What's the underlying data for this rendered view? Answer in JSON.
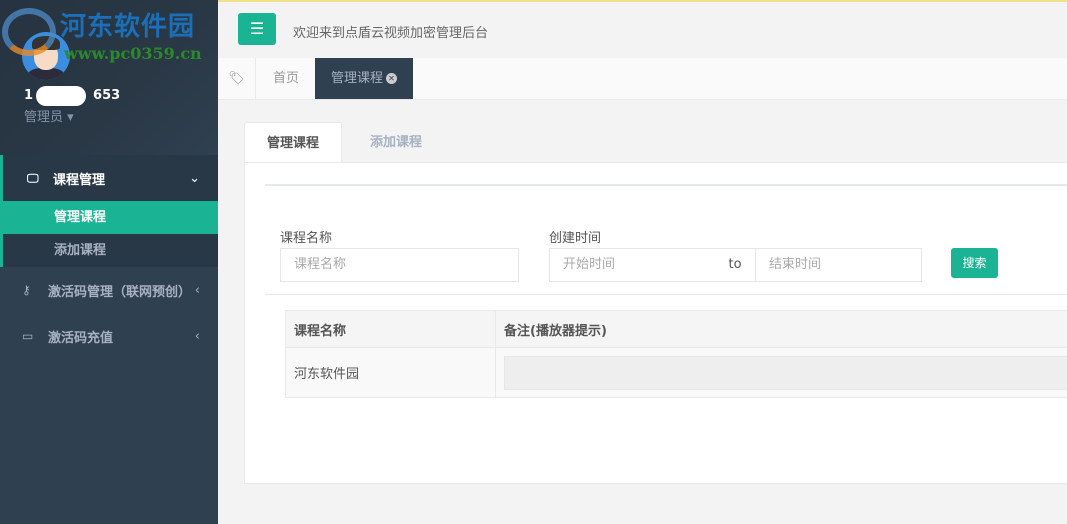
{
  "watermark": {
    "title": "河东软件园",
    "url": "www.pc0359.cn"
  },
  "user": {
    "name_suffix": "653",
    "name_prefix": "1",
    "role": "管理员"
  },
  "sidebar": {
    "course_group": {
      "label": "课程管理",
      "items": [
        {
          "label": "管理课程"
        },
        {
          "label": "添加课程"
        }
      ]
    },
    "items": [
      {
        "label": "激活码管理（联网预创）"
      },
      {
        "label": "激活码充值"
      }
    ]
  },
  "header": {
    "welcome": "欢迎来到点盾云视频加密管理后台"
  },
  "page_tabs": {
    "home": "首页",
    "active": "管理课程"
  },
  "content_tabs": [
    {
      "label": "管理课程"
    },
    {
      "label": "添加课程"
    }
  ],
  "search": {
    "name_label": "课程名称",
    "name_placeholder": "课程名称",
    "time_label": "创建时间",
    "start_placeholder": "开始时间",
    "to": "to",
    "end_placeholder": "结束时间",
    "button": "搜索"
  },
  "table": {
    "columns": [
      "课程名称",
      "备注(播放器提示)"
    ],
    "rows": [
      {
        "name": "河东软件园",
        "remark": ""
      }
    ]
  }
}
